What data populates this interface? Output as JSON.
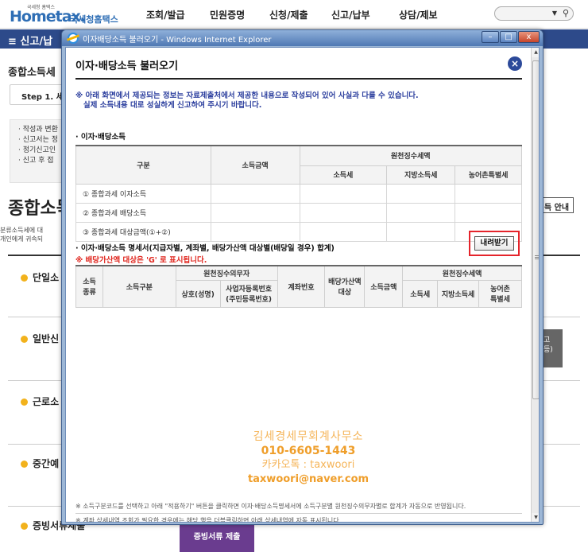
{
  "site": {
    "logo_tiny": "국세청 홈택스",
    "logo_main": "Hometax.",
    "logo_sub": "국세청홈택스",
    "nav": [
      "조회/발급",
      "민원증명",
      "신청/제출",
      "신고/납부",
      "상담/제보"
    ],
    "menu_bar_title": "≡ 신고/납"
  },
  "page": {
    "title": "종합소득세 ",
    "step": "Step 1. 세금",
    "bullets": [
      "· 작성과 변환",
      "· 신고서는 정",
      "· 정기신고인",
      "· 신고 후 접"
    ],
    "big_title": "종합소득",
    "desc": [
      "분류소득세에 대",
      "개인에게 귀속되"
    ],
    "sections": [
      "단일소",
      "일반신",
      "근로소",
      "중간예",
      "증빙서류제출"
    ],
    "right_btn": "득 안내",
    "right_gray": "고\n등)",
    "submit": "증빙서류 제출"
  },
  "ie": {
    "window_title": "이자배당소득 불러오기 - Windows Internet Explorer",
    "min": "–",
    "max": "□",
    "close": "x"
  },
  "popup": {
    "title": "이자·배당소득 불러오기",
    "close": "×",
    "notice_line1": "※ 아래 화면에서 제공되는 정보는 자료제출처에서 제공한 내용으로 작성되어 있어 사실과 다를 수 있습니다.",
    "notice_line2": "   실제 소득내용 대로 성실하게 신고하여 주시기 바랍니다.",
    "section1": "· 이자·배당소득",
    "table1": {
      "h_gubun": "구분",
      "h_amount": "소득금액",
      "h_withholding": "원천징수세액",
      "h_income_tax": "소득세",
      "h_local_tax": "지방소득세",
      "h_farm_tax": "농어촌특별세",
      "rows": [
        "① 종합과세 이자소득",
        "② 종합과세 배당소득",
        "③ 종합과세 대상금액(①+②)"
      ]
    },
    "section2": "· 이자·배당소득 명세서(지급자별, 계좌별, 배당가산액 대상별(배당일 경우) 합계)",
    "red_note": "※ 배당가산액 대상은 'G' 로 표시됩니다.",
    "download_btn": "내려받기",
    "table2": {
      "h_type": "소득\n종류",
      "h_category": "소득구분",
      "h_payer": "원천징수의무자",
      "h_name": "상호(성명)",
      "h_bizno": "사업자등록번호\n(주민등록번호)",
      "h_account": "계좌번호",
      "h_dividend": "배당가산액\n대상",
      "h_amount": "소득금액",
      "h_withholding": "원천징수세액",
      "h_income_tax": "소득세",
      "h_local_tax": "지방소득세",
      "h_farm_tax": "농어촌\n특별세"
    },
    "watermark": [
      "김세경세무회계사무소",
      "010-6605-1443",
      "카카오톡 : taxwoori",
      "taxwoori@naver.com"
    ],
    "footer1": "※ 소득구분코드를 선택하고 아래 \"적용하기\" 버튼을 클릭하면 이자·배당소득명세서에 소득구분별 원천징수의무자별로 합계가 자동으로 반영됩니다.",
    "footer2": "※ 계좌 상세내역 조회가 필요한 경우에는 해당 행을 더블클릭하면 아래 상세내역에 자동 표시됩니다."
  }
}
